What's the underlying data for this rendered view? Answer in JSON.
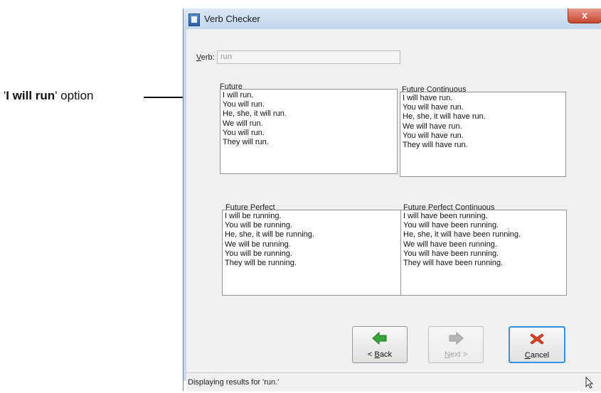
{
  "callout": {
    "bold": "I will run",
    "rest": "' option",
    "open_quote": "'"
  },
  "window": {
    "title": "Verb Checker",
    "close_glyph": "x"
  },
  "verb": {
    "label_key": "V",
    "label_rest": "erb:",
    "value": "run"
  },
  "groups": {
    "future": {
      "title_key": "F",
      "title_rest": "uture",
      "lines": [
        "I will run.",
        "You will run.",
        "He, she, it will run.",
        "We will run.",
        "You will run.",
        "They will run."
      ]
    },
    "future_continuous": {
      "title_pre": "Future C",
      "title_key": "o",
      "title_rest": "ntinuous",
      "lines": [
        "I will have run.",
        "You will have run.",
        "He, she, it will have run.",
        "We will have run.",
        "You will have run.",
        "They will have run."
      ]
    },
    "future_perfect": {
      "title_pre": "Future ",
      "title_key": "P",
      "title_rest": "erfect",
      "lines": [
        "I will be running.",
        "You will be running.",
        "He, she, it will be running.",
        "We will be running.",
        "You will be running.",
        "They will be running."
      ]
    },
    "future_perfect_continuous": {
      "title_pre": "F",
      "title_key": "u",
      "title_rest": "ture Perfect Continuous",
      "lines": [
        "I will have been running.",
        "You will have been running.",
        "He, she, it will have been running.",
        "We will have been running.",
        "You will have been running.",
        "They will have been running."
      ]
    }
  },
  "buttons": {
    "back": {
      "pre": "< ",
      "key": "B",
      "rest": "ack",
      "icon": "left-arrow-icon",
      "color": "#3aa53a"
    },
    "next": {
      "key": "N",
      "rest": "ext >",
      "icon": "right-arrow-icon",
      "color": "#a9a9a9"
    },
    "cancel": {
      "key": "C",
      "rest": "ancel",
      "icon": "x-icon",
      "color": "#e0472a"
    }
  },
  "status": {
    "text": "Displaying results for 'run.'"
  }
}
